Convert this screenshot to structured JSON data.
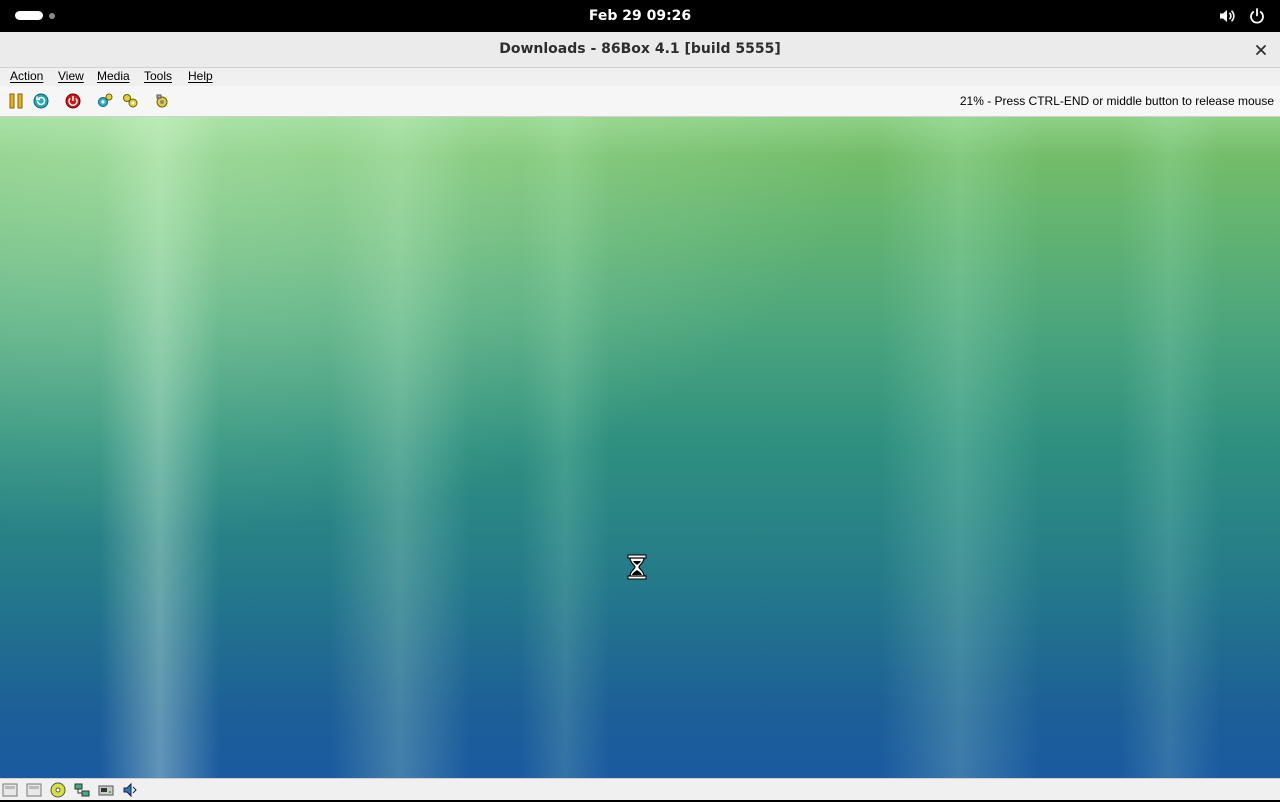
{
  "topbar": {
    "clock": "Feb 29  09:26",
    "icons": [
      "activities-indicator",
      "volume-icon",
      "power-icon"
    ]
  },
  "window": {
    "title": "Downloads - 86Box 4.1 [build 5555]",
    "close_icon": "close-icon"
  },
  "menu": {
    "items": [
      "Action",
      "View",
      "Media",
      "Tools",
      "Help"
    ]
  },
  "toolbar": {
    "buttons": [
      "pause-icon",
      "hard-reset-icon",
      "power-off-icon",
      "settings-icon",
      "ctrl-alt-del-icon",
      "screenshot-icon"
    ],
    "status_message": "21% - Press CTRL-END or middle button to release mouse"
  },
  "guest": {
    "cursor": "hourglass-icon"
  },
  "statusbar": {
    "icons": [
      "floppy-drive-icon",
      "floppy-drive-2-icon",
      "cdrom-drive-icon",
      "network-icon",
      "hard-disk-icon",
      "sound-icon"
    ]
  },
  "colors": {
    "accent_green": "#73bd6a",
    "accent_blue": "#1a5aa0"
  }
}
